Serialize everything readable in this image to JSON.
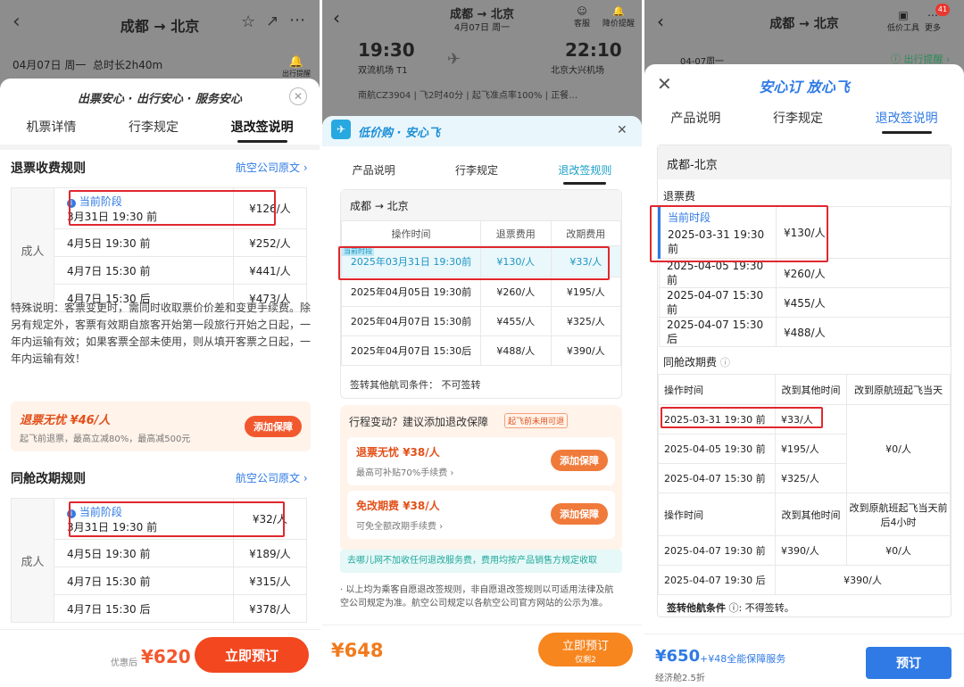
{
  "p1": {
    "header": {
      "title": "成都 → 北京",
      "date": "04月07日 周一",
      "duration": "总时长2h40m",
      "alert": "出行提醒"
    },
    "slogan": "出票安心 · 出行安心 · 服务安心",
    "tabs": [
      "机票详情",
      "行李规定",
      "退改签说明"
    ],
    "refund": {
      "title": "退票收费规则",
      "link": "航空公司原文 ›",
      "pax": "成人",
      "rows": [
        {
          "stage": "当前阶段",
          "time": "3月31日 19:30 前",
          "fee": "¥126/人"
        },
        {
          "time": "4月5日 19:30 前",
          "fee": "¥252/人"
        },
        {
          "time": "4月7日 15:30 前",
          "fee": "¥441/人"
        },
        {
          "time": "4月7日 15:30 后",
          "fee": "¥473/人"
        }
      ]
    },
    "note": "特殊说明：客票变更时，需同时收取票价价差和变更手续费。除另有规定外，客票有效期自旅客开始第一段旅行开始之日起，一年内运输有效；如果客票全部未使用，则从填开客票之日起，一年内运输有效！",
    "ins": {
      "name": "退票无忧",
      "price": "¥46/人",
      "desc": "起飞前退票，最高立减80%，最高减500元",
      "btn": "添加保障"
    },
    "change": {
      "title": "同舱改期规则",
      "link": "航空公司原文 ›",
      "pax": "成人",
      "rows": [
        {
          "stage": "当前阶段",
          "time": "3月31日 19:30 前",
          "fee": "¥32/人"
        },
        {
          "time": "4月5日 19:30 前",
          "fee": "¥189/人"
        },
        {
          "time": "4月7日 15:30 前",
          "fee": "¥315/人"
        },
        {
          "time": "4月7日 15:30 后",
          "fee": "¥378/人"
        }
      ]
    },
    "footer": {
      "prefix": "优惠后",
      "price": "¥620",
      "btn": "立即预订"
    }
  },
  "p2": {
    "header": {
      "title": "成都 → 北京",
      "date": "4月07日 周一",
      "service": "客服",
      "alert": "降价提醒"
    },
    "flight": {
      "dep_time": "19:30",
      "dep_airport": "双流机场 T1",
      "arr_time": "22:10",
      "arr_airport": "北京大兴机场",
      "info": "南航CZ3904 | 飞2时40分 | 起飞准点率100% | 正餐…"
    },
    "sheet": {
      "brand": "低价购 · 安心飞",
      "tabs": [
        "产品说明",
        "行李规定",
        "退改签规则"
      ],
      "route": "成都 → 北京",
      "headers": [
        "操作时间",
        "退票费用",
        "改期费用"
      ],
      "stage": "当前时段",
      "rows": [
        {
          "time": "2025年03月31日 19:30前",
          "refund": "¥130/人",
          "change": "¥33/人"
        },
        {
          "time": "2025年04月05日 19:30前",
          "refund": "¥260/人",
          "change": "¥195/人"
        },
        {
          "time": "2025年04月07日 15:30前",
          "refund": "¥455/人",
          "change": "¥325/人"
        },
        {
          "time": "2025年04月07日 15:30后",
          "refund": "¥488/人",
          "change": "¥390/人"
        }
      ],
      "endorse": "签转其他航司条件： 不可签转",
      "promo": {
        "title": "行程变动？建议添加退改保障",
        "tag": "起飞前未用可退",
        "items": [
          {
            "name": "退票无忧",
            "price": "¥38/人",
            "desc": "最高可补贴70%手续费 ›",
            "btn": "添加保障"
          },
          {
            "name": "免改期费",
            "price": "¥38/人",
            "desc": "可免全额改期手续费 ›",
            "btn": "添加保障"
          }
        ]
      },
      "notice": "去哪儿网不加收任何退改服务费，费用均按产品销售方规定收取",
      "bullet": "· 以上均为乘客自愿退改签规则，非自愿退改签规则以可适用法律及航空公司规定为准。航空公司规定以各航空公司官方网站的公示为准。"
    },
    "footer": {
      "price": "¥648",
      "btn": "立即预订",
      "btn_sub": "仅剩2"
    }
  },
  "p3": {
    "header": {
      "title": "成都 → 北京",
      "tool1": "低价工具",
      "tool2": "更多",
      "badge": "41",
      "date": "04-07周一",
      "alert": "出行提醒"
    },
    "brand": "安心订 放心飞",
    "tabs": [
      "产品说明",
      "行李规定",
      "退改签说明"
    ],
    "route": "成都-北京",
    "refund": {
      "title": "退票费",
      "stage": "当前时段",
      "rows": [
        {
          "time": "2025-03-31 19:30 前",
          "fee": "¥130/人"
        },
        {
          "time": "2025-04-05 19:30 前",
          "fee": "¥260/人"
        },
        {
          "time": "2025-04-07 15:30 前",
          "fee": "¥455/人"
        },
        {
          "time": "2025-04-07 15:30 后",
          "fee": "¥488/人"
        }
      ]
    },
    "change": {
      "title": "同舱改期费",
      "h1": [
        "操作时间",
        "改到其他时间",
        "改到原航班起飞当天"
      ],
      "rows1": [
        {
          "time": "2025-03-31 19:30 前",
          "fee": "¥33/人"
        },
        {
          "time": "2025-04-05 19:30 前",
          "fee": "¥195/人"
        },
        {
          "time": "2025-04-07 15:30 前",
          "fee": "¥325/人"
        }
      ],
      "same1": "¥0/人",
      "h2": [
        "操作时间",
        "改到其他时间",
        "改到原航班起飞当天前后4小时"
      ],
      "rows2": [
        {
          "time": "2025-04-07 19:30 前",
          "fee": "¥390/人",
          "same": "¥0/人"
        }
      ],
      "last": {
        "time": "2025-04-07 19:30 后",
        "fee": "¥390/人"
      }
    },
    "endorse": {
      "label": "签转他航条件",
      "value": "不得签转。"
    },
    "footer": {
      "price": "¥650",
      "extra": "+¥48全能保障服务",
      "cabin": "经济舱2.5折",
      "btn": "预订"
    }
  }
}
